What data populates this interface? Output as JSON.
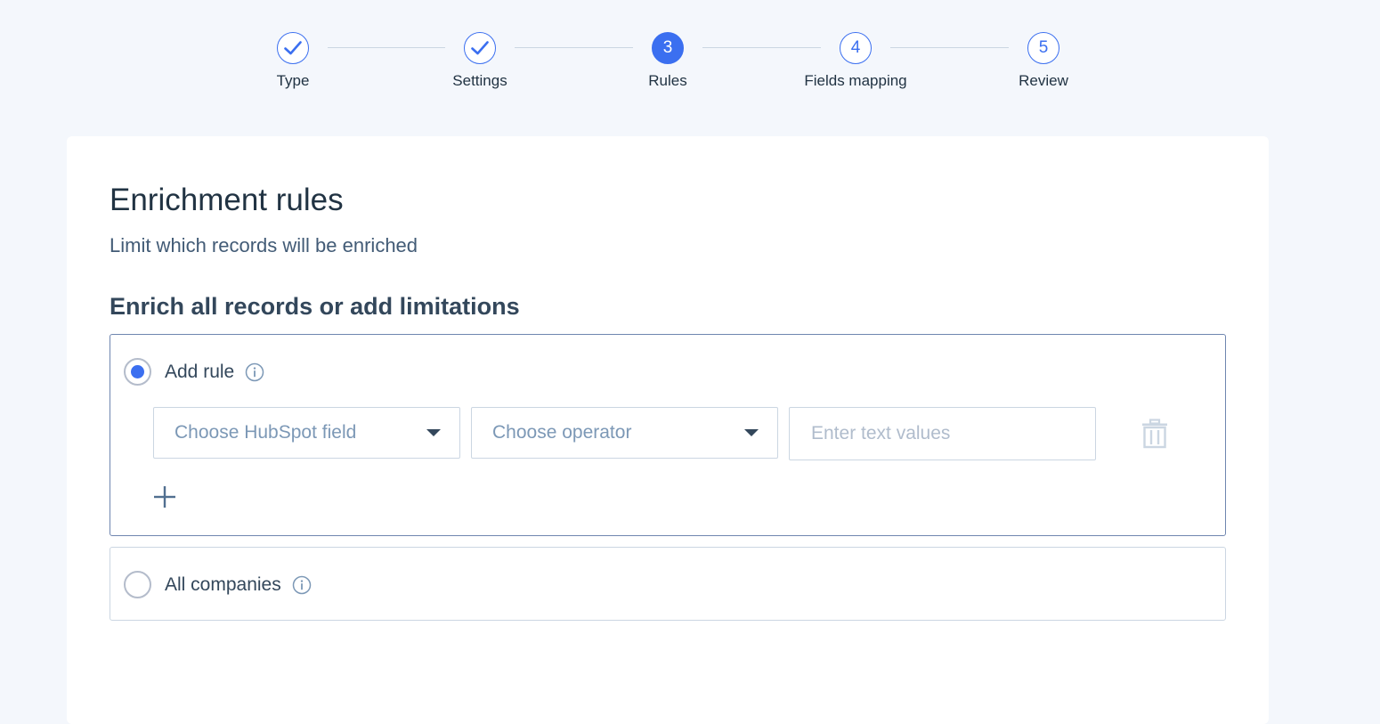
{
  "stepper": {
    "steps": [
      {
        "number": "1",
        "label": "Type",
        "state": "completed",
        "icon": "check-icon"
      },
      {
        "number": "2",
        "label": "Settings",
        "state": "completed",
        "icon": "check-icon"
      },
      {
        "number": "3",
        "label": "Rules",
        "state": "active"
      },
      {
        "number": "4",
        "label": "Fields mapping",
        "state": "upcoming"
      },
      {
        "number": "5",
        "label": "Review",
        "state": "upcoming"
      }
    ]
  },
  "card": {
    "title": "Enrichment rules",
    "subtitle": "Limit which records will be enriched",
    "section_title": "Enrich all records or add limitations"
  },
  "options": {
    "add_rule": {
      "label": "Add rule",
      "selected": true,
      "info_icon": "info-icon",
      "field_select": {
        "placeholder": "Choose HubSpot field"
      },
      "operator_select": {
        "placeholder": "Choose operator"
      },
      "value_input": {
        "placeholder": "Enter text values",
        "value": ""
      },
      "delete_icon": "trash-icon",
      "add_icon": "plus-icon"
    },
    "all_companies": {
      "label": "All companies",
      "selected": false,
      "info_icon": "info-icon"
    }
  },
  "colors": {
    "accent": "#3b6ff0",
    "background": "#f4f7fc",
    "border": "#cbd6e2"
  }
}
